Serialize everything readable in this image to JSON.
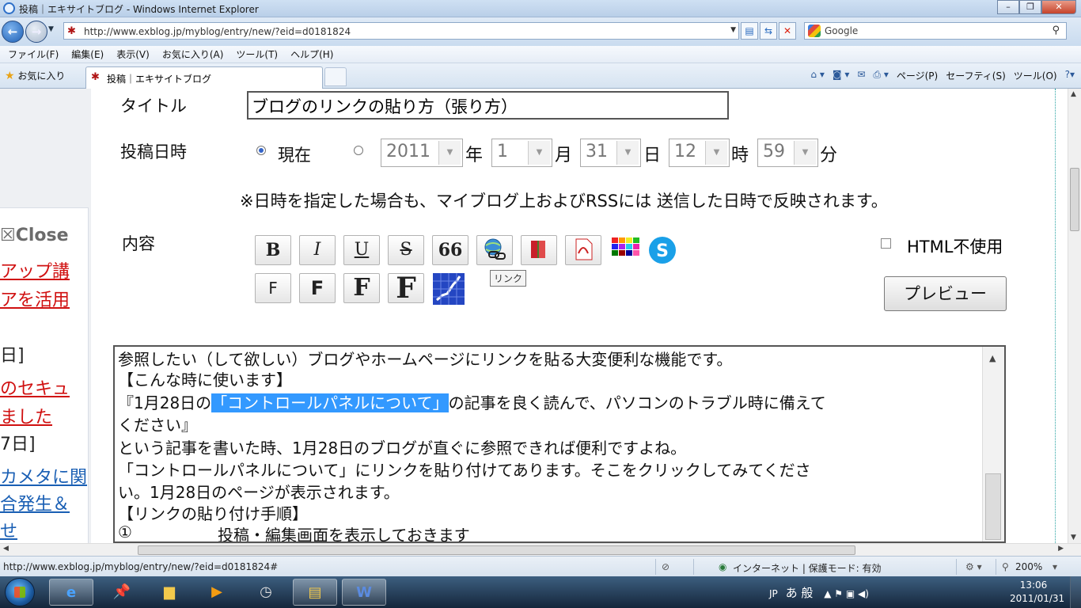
{
  "window": {
    "title": "投稿｜エキサイトブログ - Windows Internet Explorer",
    "min": "–",
    "max": "❐",
    "close": "✕"
  },
  "address": {
    "url": "http://www.exblog.jp/myblog/entry/new/?eid=d0181824",
    "search_label": "Google"
  },
  "menu": [
    "ファイル(F)",
    "編集(E)",
    "表示(V)",
    "お気に入り(A)",
    "ツール(T)",
    "ヘルプ(H)"
  ],
  "favbar": {
    "favorites": "お気に入り",
    "tab_title": "投稿｜エキサイトブログ",
    "commands": [
      "ページ(P)",
      "セーフティ(S)",
      "ツール(O)"
    ]
  },
  "sidebar": {
    "close": "☒Close",
    "links": [
      {
        "text": "アップ講",
        "color": "red"
      },
      {
        "text": "アを活用",
        "color": "red"
      },
      {
        "text": "日]",
        "color": "plain"
      },
      {
        "text": "のセキュ",
        "color": "red"
      },
      {
        "text": "ました",
        "color": "red"
      },
      {
        "text": "7日]",
        "color": "plain"
      },
      {
        "text": "カメタに関",
        "color": "blue"
      },
      {
        "text": "合発生＆",
        "color": "blue"
      },
      {
        "text": "せ",
        "color": "blue"
      }
    ]
  },
  "form": {
    "title_label": "タイトル",
    "title_value": "ブログのリンクの貼り方（張り方）",
    "date_label": "投稿日時",
    "now_label": "現在",
    "year": "2011",
    "year_unit": "年",
    "month": "1",
    "month_unit": "月",
    "day": "31",
    "day_unit": "日",
    "hour": "12",
    "hour_unit": "時",
    "minute": "59",
    "minute_unit": "分",
    "note": "※日時を指定した場合も、マイブログ上およびRSSには 送信した日時で反映されます。",
    "content_label": "内容",
    "html_off_label": "HTML不使用",
    "preview_label": "プレビュー",
    "tooltip": "リンク"
  },
  "toolbar": {
    "bold": "B",
    "italic": "I",
    "underline": "U",
    "strike": "S",
    "quote": "66",
    "font1": "F",
    "font2": "F",
    "font3": "F",
    "font4": "F"
  },
  "editor": {
    "line1": "参照したい（して欲しい）ブログやホームページにリンクを貼る大変便利な機能です。",
    "line2": "【こんな時に使います】",
    "line3_pre": "『1月28日の",
    "line3_hl": "「コントロールパネルについて」",
    "line3_post": "の記事を良く読んで、パソコンのトラブル時に備えて",
    "line4": "ください』",
    "line5": "という記事を書いた時、1月28日のブログが直ぐに参照できれば便利ですよね。",
    "line6": "「コントロールパネルについて」にリンクを貼り付けてあります。そこをクリックしてみてくださ",
    "line7": "い。1月28日のページが表示されます。",
    "line8": "【リンクの貼り付け手順】",
    "line9_num": "①",
    "line9_text": "投稿・編集画面を表示しておきます"
  },
  "status": {
    "url": "http://www.exblog.jp/myblog/entry/new/?eid=d0181824#",
    "zone": "インターネット | 保護モード: 有効",
    "zoom": "200%"
  },
  "taskbar": {
    "lang": "JP",
    "ime": "あ 般",
    "time": "13:06",
    "date": "2011/01/31"
  }
}
